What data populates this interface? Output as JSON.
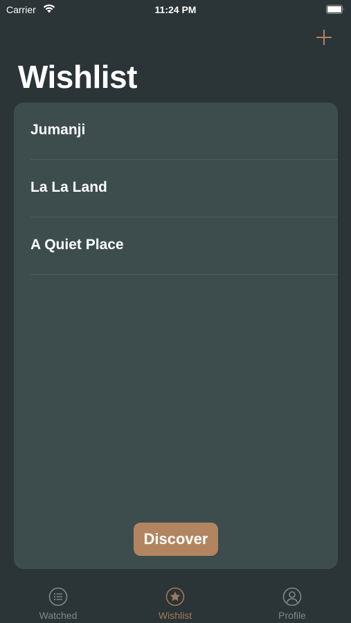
{
  "status_bar": {
    "carrier": "Carrier",
    "time": "11:24 PM",
    "icons": [
      "wifi-icon",
      "battery-icon"
    ]
  },
  "header": {
    "add_icon": "plus-icon",
    "title": "Wishlist"
  },
  "list": {
    "items": [
      {
        "label": "Jumanji"
      },
      {
        "label": "La La Land"
      },
      {
        "label": "A Quiet Place"
      }
    ]
  },
  "discover_button": {
    "label": "Discover"
  },
  "tab_bar": {
    "tabs": [
      {
        "label": "Watched",
        "icon": "list-circle-icon",
        "active": false
      },
      {
        "label": "Wishlist",
        "icon": "star-circle-icon",
        "active": true
      },
      {
        "label": "Profile",
        "icon": "person-circle-icon",
        "active": false
      }
    ]
  },
  "colors": {
    "background": "#2b3436",
    "card": "#3d4d4d",
    "accent": "#b28560",
    "tab_inactive": "#7d8b8b",
    "tab_active": "#a07a5a"
  }
}
